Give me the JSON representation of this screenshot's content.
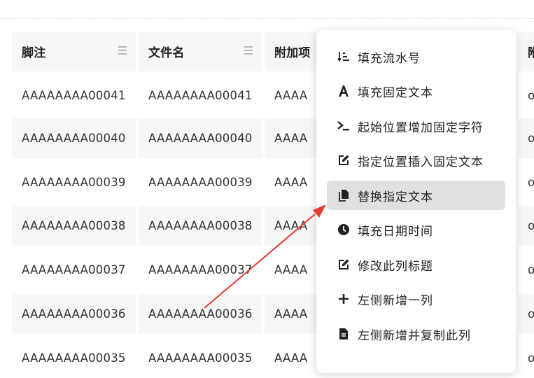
{
  "table": {
    "headers": [
      {
        "label": "脚注"
      },
      {
        "label": "文件名"
      },
      {
        "label": "附加项"
      },
      {
        "label": "附"
      }
    ],
    "rows": [
      {
        "footnote": "AAAAAAAA00041",
        "filename": "AAAAAAAA00041",
        "extra": "AAAA",
        "last": "o"
      },
      {
        "footnote": "AAAAAAAA00040",
        "filename": "AAAAAAAA00040",
        "extra": "AAAA",
        "last": "o"
      },
      {
        "footnote": "AAAAAAAA00039",
        "filename": "AAAAAAAA00039",
        "extra": "AAAA",
        "last": "o"
      },
      {
        "footnote": "AAAAAAAA00038",
        "filename": "AAAAAAAA00038",
        "extra": "AAAA",
        "last": "o"
      },
      {
        "footnote": "AAAAAAAA00037",
        "filename": "AAAAAAAA00037",
        "extra": "AAAA",
        "last": "o"
      },
      {
        "footnote": "AAAAAAAA00036",
        "filename": "AAAAAAAA00036",
        "extra": "AAAA",
        "last": "o"
      },
      {
        "footnote": "AAAAAAAA00035",
        "filename": "AAAAAAAA00035",
        "extra": "AAAA",
        "last": "o"
      }
    ]
  },
  "context_menu": {
    "items": [
      {
        "label": "填充流水号",
        "icon": "sort-numeric-icon"
      },
      {
        "label": "填充固定文本",
        "icon": "font-a-icon"
      },
      {
        "label": "起始位置增加固定字符",
        "icon": "terminal-prompt-icon"
      },
      {
        "label": "指定位置插入固定文本",
        "icon": "edit-square-icon"
      },
      {
        "label": "替换指定文本",
        "icon": "copy-document-icon",
        "highlighted": true
      },
      {
        "label": "填充日期时间",
        "icon": "clock-icon"
      },
      {
        "label": "修改此列标题",
        "icon": "edit-square-icon"
      },
      {
        "label": "左侧新增一列",
        "icon": "plus-icon"
      },
      {
        "label": "左侧新增并复制此列",
        "icon": "document-icon"
      }
    ]
  },
  "colors": {
    "annotation_arrow": "#e53a2f",
    "highlight": "#e0e0e0",
    "cell_background": "#f7f7f7"
  }
}
